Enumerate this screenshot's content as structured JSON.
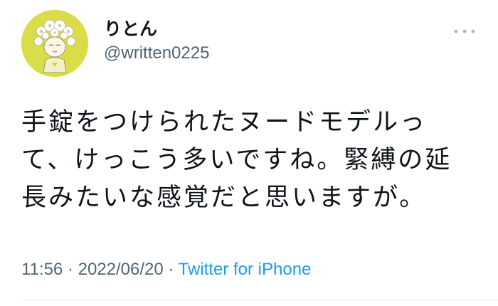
{
  "author": {
    "display_name": "りとん",
    "handle": "@written0225"
  },
  "tweet": {
    "text": "手錠をつけられたヌードモデルっ\nて、けっこう多いですね。緊縛の延\n長みたいな感覚だと思いますが。",
    "time": "11:56",
    "separator": " · ",
    "date": "2022/06/20",
    "source": "Twitter for iPhone"
  },
  "icons": {
    "avatar": "avatar-image",
    "more": "more-options-icon"
  },
  "colors": {
    "text": "#0f1419",
    "secondary": "#536471",
    "link": "#1d9bf0",
    "avatar_bg": "#d9dd47"
  }
}
